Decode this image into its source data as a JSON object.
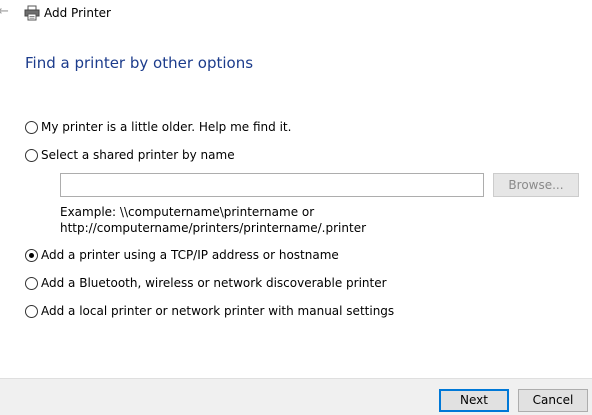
{
  "window": {
    "title": "Add Printer",
    "back_icon": "back-arrow-icon",
    "title_icon": "printer-icon"
  },
  "heading": "Find a printer by other options",
  "options": [
    {
      "label": "My printer is a little older. Help me find it.",
      "checked": false
    },
    {
      "label": "Select a shared printer by name",
      "checked": false
    },
    {
      "label": "Add a printer using a TCP/IP address or hostname",
      "checked": true
    },
    {
      "label": "Add a Bluetooth, wireless or network discoverable printer",
      "checked": false
    },
    {
      "label": "Add a local printer or network printer with manual settings",
      "checked": false
    }
  ],
  "shared_printer": {
    "value": "",
    "browse_label": "Browse...",
    "example_line1": "Example: \\\\computername\\printername or",
    "example_line2": "http://computername/printers/printername/.printer"
  },
  "footer": {
    "next_label": "Next",
    "cancel_label": "Cancel"
  },
  "colors": {
    "heading": "#1c3c8c",
    "accent": "#0078d7"
  }
}
